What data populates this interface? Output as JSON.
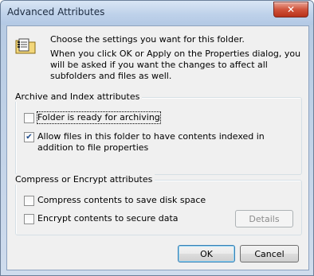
{
  "window": {
    "title": "Advanced Attributes",
    "close_glyph": "✕"
  },
  "intro": {
    "line1": "Choose the settings you want for this folder.",
    "line2": "When you click OK or Apply on the Properties dialog, you will be asked if you want the changes to affect all subfolders and files as well."
  },
  "archive_group": {
    "legend": "Archive and Index attributes",
    "folder_ready": {
      "label": "Folder is ready for archiving",
      "checked": false
    },
    "allow_index": {
      "label": "Allow files in this folder to have contents indexed in addition to file properties",
      "checked": true
    }
  },
  "compress_group": {
    "legend": "Compress or Encrypt attributes",
    "compress": {
      "label": "Compress contents to save disk space",
      "checked": false
    },
    "encrypt": {
      "label": "Encrypt contents to secure data",
      "checked": false
    },
    "details_label": "Details"
  },
  "buttons": {
    "ok": "OK",
    "cancel": "Cancel"
  },
  "glyphs": {
    "check": "✔"
  }
}
